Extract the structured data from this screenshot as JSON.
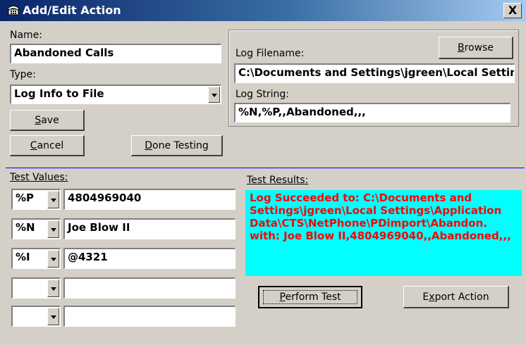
{
  "window": {
    "title": "Add/Edit Action",
    "close_glyph": "X"
  },
  "name": {
    "label": "Name:",
    "value": "Abandoned Calls"
  },
  "type": {
    "label": "Type:",
    "value": "Log Info to File"
  },
  "buttons": {
    "save_prefix": "",
    "save_ul": "S",
    "save_rest": "ave",
    "cancel_prefix": "",
    "cancel_ul": "C",
    "cancel_rest": "ancel",
    "done_prefix": "",
    "done_ul": "D",
    "done_rest": "one Testing",
    "browse_prefix": "",
    "browse_ul": "B",
    "browse_rest": "rowse",
    "perform_prefix": "",
    "perform_ul": "P",
    "perform_rest": "erform Test",
    "export_prefix": "E",
    "export_ul": "x",
    "export_rest": "port Action"
  },
  "log": {
    "filename_label": "Log Filename:",
    "filename_value": "C:\\Documents and Settings\\jgreen\\Local Settings\\Application Data\\CTS\\NetPhone\\PDimport\\Abandon.",
    "string_label": "Log String:",
    "string_value": "%N,%P,,Abandoned,,,"
  },
  "test_values": {
    "label": "Test Values:",
    "rows": [
      {
        "code": "%P",
        "value": "4804969040"
      },
      {
        "code": "%N",
        "value": "Joe Blow II"
      },
      {
        "code": "%I",
        "value": "@4321"
      },
      {
        "code": "",
        "value": ""
      },
      {
        "code": "",
        "value": ""
      }
    ]
  },
  "test_results": {
    "label": "Test Results:",
    "text": "Log Succeeded to: C:\\Documents and Settings\\jgreen\\Local Settings\\Application Data\\CTS\\NetPhone\\PDimport\\Abandon. with: Joe Blow II,4804969040,,Abandoned,,,"
  },
  "colors": {
    "results_bg": "#00ffff",
    "results_text": "#ff0000",
    "separator": "#0000ff"
  }
}
